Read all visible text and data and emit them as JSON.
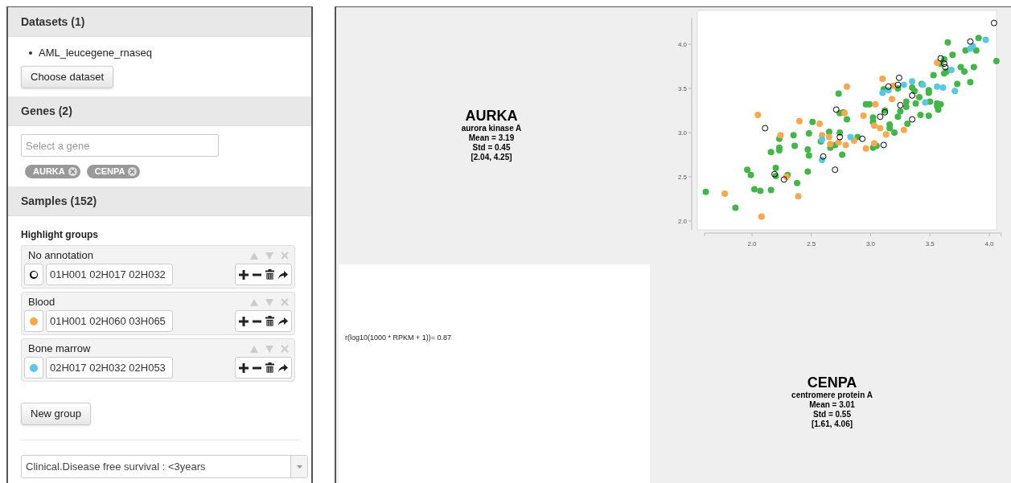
{
  "sidebar": {
    "datasets": {
      "title": "Datasets (1)",
      "items": [
        "AML_leucegene_rnaseq"
      ],
      "button": "Choose dataset"
    },
    "genes": {
      "title": "Genes (2)",
      "search": {
        "placeholder": "Select a gene"
      },
      "tags": [
        "AURKA",
        "CENPA"
      ]
    },
    "samples": {
      "title": "Samples (152)",
      "subtitle": "Highlight groups",
      "groups": [
        {
          "name": "No annotation",
          "kind": "hollow",
          "color": "#000000",
          "value": "01H001 02H017 02H032"
        },
        {
          "name": "Blood",
          "kind": "filled",
          "color": "#f9a84e",
          "value": "01H001 02H060 03H065"
        },
        {
          "name": "Bone marrow",
          "kind": "filled",
          "color": "#5bc8e3",
          "value": "02H017 02H032 02H053"
        }
      ],
      "new_group_button": "New group",
      "filter": {
        "value": "Clinical.Disease free survival : <3years"
      }
    }
  },
  "main": {
    "gene_cards": [
      {
        "symbol": "AURKA",
        "name": "aurora kinase A",
        "mean": "Mean = 3.19",
        "std": "Std = 0.45",
        "range": "[2.04, 4.25]"
      },
      {
        "symbol": "CENPA",
        "name": "centromere protein A",
        "mean": "Mean = 3.01",
        "std": "Std = 0.55",
        "range": "[1.61, 4.06]"
      }
    ],
    "correlation": "r(log10(1000 * RPKM + 1))= 0.87",
    "chart_data": {
      "type": "scatter",
      "xlim": [
        1.6,
        4.1
      ],
      "ylim": [
        1.9,
        4.3
      ],
      "xticks": [
        {
          "value": 2,
          "label": "2.0"
        },
        {
          "value": 2.5,
          "label": "2.5"
        },
        {
          "value": 3,
          "label": "3.0"
        },
        {
          "value": 3.5,
          "label": "3.5"
        },
        {
          "value": 4,
          "label": "4.0"
        }
      ],
      "yticks": [
        {
          "value": 2,
          "label": "2.0"
        },
        {
          "value": 2.5,
          "label": "2.5"
        },
        {
          "value": 3,
          "label": "3.0"
        },
        {
          "value": 3.5,
          "label": "3.5"
        },
        {
          "value": 4,
          "label": "4.0"
        }
      ],
      "series": [
        {
          "color": "#42b649",
          "x": [
            1.61,
            1.86,
            1.96,
            1.99,
            2.02,
            2.07,
            2.16,
            2.16,
            2.2,
            2.2,
            2.23,
            2.23,
            2.23,
            2.3,
            2.35,
            2.36,
            2.38,
            2.47,
            2.47,
            2.48,
            2.48,
            2.51,
            2.58,
            2.65,
            2.66,
            2.7,
            2.73,
            2.74,
            2.74,
            2.76,
            2.77,
            2.8,
            2.89,
            2.96,
            2.99,
            3.02,
            3.02,
            3.02,
            3.05,
            3.11,
            3.12,
            3.16,
            3.16,
            3.2,
            3.23,
            3.23,
            3.25,
            3.3,
            3.3,
            3.31,
            3.35,
            3.37,
            3.38,
            3.41,
            3.42,
            3.43,
            3.49,
            3.49,
            3.49,
            3.5,
            3.53,
            3.56,
            3.57,
            3.56,
            3.59,
            3.62,
            3.62,
            3.64,
            3.65,
            3.69,
            3.73,
            3.76,
            3.79,
            3.8,
            3.84,
            3.87,
            3.89,
            3.91,
            4.06,
            3.59
          ],
          "values": [
            2.33,
            2.15,
            2.58,
            2.52,
            2.36,
            2.34,
            2.35,
            2.78,
            2.6,
            2.51,
            2.93,
            2.83,
            2.8,
            2.52,
            2.97,
            2.85,
            2.43,
            2.81,
            2.56,
            2.74,
            2.99,
            3.12,
            2.9,
            3.01,
            2.83,
            2.86,
            3.44,
            3.0,
            3.22,
            2.75,
            3.23,
            3.15,
            2.95,
            3.32,
            3.32,
            3.12,
            3.17,
            2.83,
            2.85,
            3.49,
            3.25,
            3.09,
            3.05,
            3.0,
            3.18,
            3.5,
            3.24,
            3.35,
            3.29,
            3.1,
            3.51,
            3.47,
            3.33,
            3.4,
            3.2,
            3.55,
            3.45,
            3.48,
            3.19,
            3.35,
            3.65,
            3.33,
            3.26,
            3.3,
            3.32,
            3.83,
            3.67,
            3.69,
            4.02,
            3.88,
            3.55,
            3.74,
            3.69,
            3.93,
            3.57,
            3.74,
            3.93,
            4.07,
            3.81,
            3.78
          ]
        },
        {
          "color": "#f9a84e",
          "x": [
            2.05,
            1.77,
            2.08,
            2.24,
            2.29,
            2.39,
            2.4,
            2.57,
            2.59,
            2.65,
            2.66,
            2.73,
            2.78,
            2.79,
            2.8,
            2.86,
            2.94,
            2.96,
            3.03,
            3.03,
            3.04,
            3.08,
            3.1,
            3.13,
            3.18,
            3.19,
            3.28,
            3.56
          ],
          "values": [
            3.2,
            2.31,
            2.05,
            2.97,
            2.5,
            2.28,
            3.13,
            3.1,
            2.97,
            2.95,
            2.87,
            2.89,
            3.22,
            2.86,
            3.52,
            2.91,
            3.19,
            2.82,
            3.08,
            2.88,
            3.32,
            3.05,
            3.61,
            2.98,
            3.38,
            3.53,
            3.03,
            3.79
          ]
        },
        {
          "color": "#5bc8e3",
          "x": [
            2.59,
            2.59,
            2.83,
            3.1,
            3.15,
            3.28,
            3.35,
            3.44,
            3.46,
            3.56,
            3.61,
            3.68,
            3.71,
            3.84,
            3.97,
            3.86
          ],
          "values": [
            2.92,
            2.69,
            2.95,
            3.45,
            3.48,
            3.54,
            3.58,
            3.54,
            3.34,
            3.52,
            3.51,
            3.71,
            3.47,
            3.95,
            4.05,
            3.98
          ]
        },
        {
          "color": "#000000",
          "x": [
            2.11,
            2.19,
            2.27,
            2.6,
            2.7,
            2.71,
            2.74,
            2.93,
            3.08,
            3.12,
            3.11,
            3.15,
            3.23,
            3.24,
            3.25,
            3.35,
            3.35,
            3.59,
            3.62,
            3.63,
            3.84,
            4.04
          ],
          "values": [
            3.05,
            2.53,
            2.47,
            2.73,
            2.58,
            3.26,
            2.95,
            2.93,
            3.18,
            3.23,
            2.86,
            3.52,
            3.54,
            3.62,
            3.31,
            3.42,
            3.15,
            3.84,
            3.78,
            3.74,
            4.03,
            4.24
          ]
        }
      ]
    }
  }
}
